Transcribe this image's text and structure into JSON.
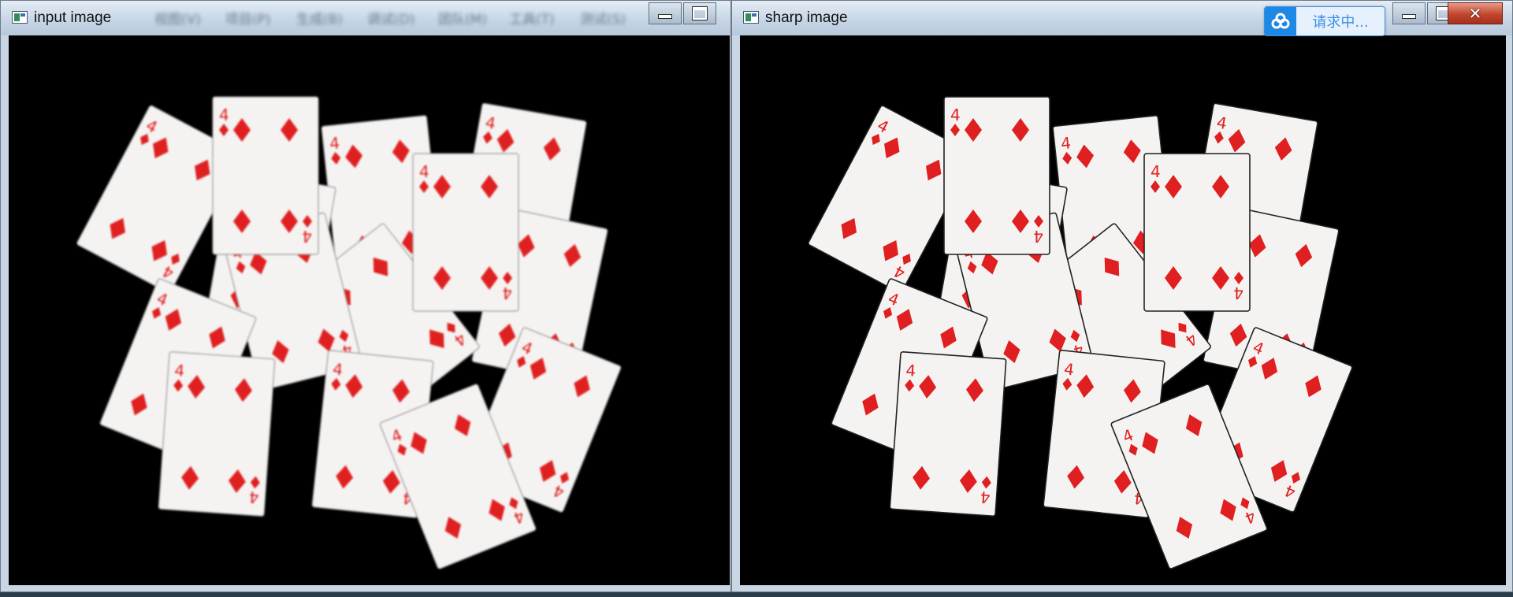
{
  "windows": {
    "left": {
      "title": "input image",
      "variant": "blur"
    },
    "right": {
      "title": "sharp image",
      "variant": "sharp"
    }
  },
  "blurred_menu": [
    "视图(V)",
    "项目(P)",
    "生成(B)",
    "调试(D)",
    "团队(M)",
    "工具(T)",
    "测试(S)"
  ],
  "badge": {
    "text": "请求中...",
    "icon": "cloud-sync-icon"
  },
  "cards": {
    "rank": "4",
    "suit": "diamonds",
    "pip_color": "#e02020",
    "face_color": "#f5f3f2"
  },
  "colors": {
    "titlebar": "#c7d6e6",
    "close": "#c1452c",
    "canvas": "#000000"
  }
}
